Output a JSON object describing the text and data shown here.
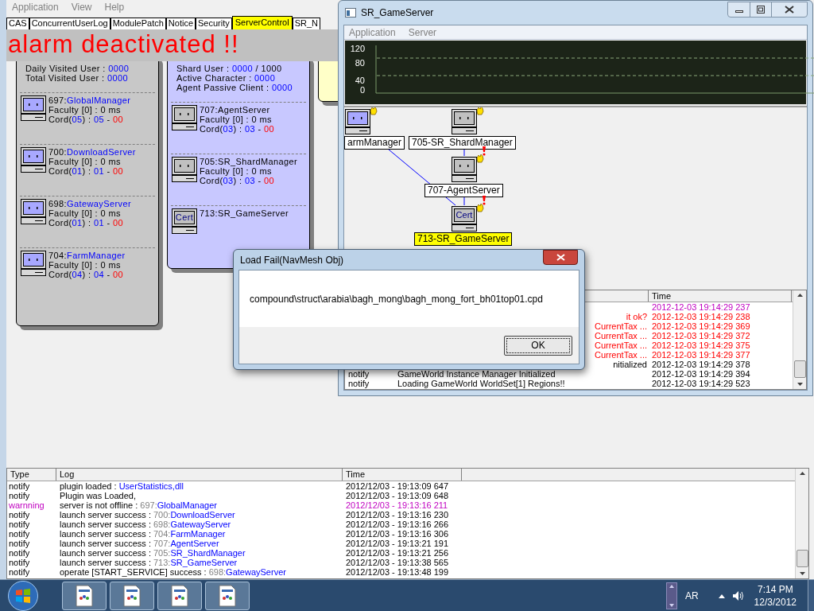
{
  "main_window": {
    "menu": [
      {
        "label": "Application"
      },
      {
        "label": "View"
      },
      {
        "label": "Help"
      }
    ],
    "tabs": [
      {
        "label": "CAS",
        "selected": false
      },
      {
        "label": "ConcurrentUserLog",
        "selected": false
      },
      {
        "label": "ModulePatch",
        "selected": false
      },
      {
        "label": "Notice",
        "selected": false
      },
      {
        "label": "Security",
        "selected": false
      },
      {
        "label": "ServerControl",
        "selected": true
      },
      {
        "label": "SR_N",
        "selected": false
      }
    ],
    "alarm": "alarm deactivated !!",
    "panels": [
      {
        "kind": "gray",
        "stats": [
          {
            "segments": [
              {
                "text": "Daily Visited User : ",
                "kind": "plain"
              },
              {
                "text": "0000",
                "kind": "link"
              }
            ]
          },
          {
            "segments": [
              {
                "text": "Total Visited User : ",
                "kind": "plain"
              },
              {
                "text": "0000",
                "kind": "link"
              }
            ]
          }
        ],
        "servers": [
          {
            "kind": "blue",
            "lines": [
              [
                {
                  "text": "697:",
                  "kind": "plain"
                },
                {
                  "text": "GlobalManager",
                  "kind": "link"
                }
              ],
              [
                {
                  "text": "Faculty [0] : 0 ms",
                  "kind": "plain"
                }
              ],
              [
                {
                  "text": "Cord(",
                  "kind": "plain"
                },
                {
                  "text": "05",
                  "kind": "link"
                },
                {
                  "text": ") : ",
                  "kind": "plain"
                },
                {
                  "text": "05",
                  "kind": "link"
                },
                {
                  "text": " - ",
                  "kind": "plain"
                },
                {
                  "text": "00",
                  "kind": "alert"
                }
              ]
            ]
          },
          {
            "kind": "blue",
            "lines": [
              [
                {
                  "text": "700:",
                  "kind": "plain"
                },
                {
                  "text": "DownloadServer",
                  "kind": "link"
                }
              ],
              [
                {
                  "text": "Faculty [0] : 0 ms",
                  "kind": "plain"
                }
              ],
              [
                {
                  "text": "Cord(",
                  "kind": "plain"
                },
                {
                  "text": "01",
                  "kind": "link"
                },
                {
                  "text": ") : ",
                  "kind": "plain"
                },
                {
                  "text": "01",
                  "kind": "link"
                },
                {
                  "text": " - ",
                  "kind": "plain"
                },
                {
                  "text": "00",
                  "kind": "alert"
                }
              ]
            ]
          },
          {
            "kind": "blue",
            "lines": [
              [
                {
                  "text": "698:",
                  "kind": "plain"
                },
                {
                  "text": "GatewayServer",
                  "kind": "link"
                }
              ],
              [
                {
                  "text": "Faculty [0] : 0 ms",
                  "kind": "plain"
                }
              ],
              [
                {
                  "text": "Cord(",
                  "kind": "plain"
                },
                {
                  "text": "01",
                  "kind": "link"
                },
                {
                  "text": ") : ",
                  "kind": "plain"
                },
                {
                  "text": "01",
                  "kind": "link"
                },
                {
                  "text": " - ",
                  "kind": "plain"
                },
                {
                  "text": "00",
                  "kind": "alert"
                }
              ]
            ]
          },
          {
            "kind": "blue",
            "lines": [
              [
                {
                  "text": "704:",
                  "kind": "plain"
                },
                {
                  "text": "FarmManager",
                  "kind": "link"
                }
              ],
              [
                {
                  "text": "Faculty [0] : 0 ms",
                  "kind": "plain"
                }
              ],
              [
                {
                  "text": "Cord(",
                  "kind": "plain"
                },
                {
                  "text": "04",
                  "kind": "link"
                },
                {
                  "text": ") : ",
                  "kind": "plain"
                },
                {
                  "text": "04",
                  "kind": "link"
                },
                {
                  "text": " - ",
                  "kind": "plain"
                },
                {
                  "text": "00",
                  "kind": "alert"
                }
              ]
            ]
          }
        ]
      },
      {
        "kind": "blue",
        "stats": [
          {
            "segments": [
              {
                "text": "Shard User : ",
                "kind": "plain"
              },
              {
                "text": "0000",
                "kind": "link"
              },
              {
                "text": " / 1000",
                "kind": "plain"
              }
            ]
          },
          {
            "segments": [
              {
                "text": "Active Character : ",
                "kind": "plain"
              },
              {
                "text": "0000",
                "kind": "link"
              }
            ]
          },
          {
            "segments": [
              {
                "text": "Agent Passive Client : ",
                "kind": "plain"
              },
              {
                "text": "0000",
                "kind": "link"
              }
            ]
          }
        ],
        "servers": [
          {
            "kind": "gray",
            "lines": [
              [
                {
                  "text": "707:AgentServer",
                  "kind": "plain"
                }
              ],
              [
                {
                  "text": "Faculty [0] : 0 ms",
                  "kind": "plain"
                }
              ],
              [
                {
                  "text": "Cord(",
                  "kind": "plain"
                },
                {
                  "text": "03",
                  "kind": "link"
                },
                {
                  "text": ") : ",
                  "kind": "plain"
                },
                {
                  "text": "03",
                  "kind": "link"
                },
                {
                  "text": " - ",
                  "kind": "plain"
                },
                {
                  "text": "00",
                  "kind": "alert"
                }
              ]
            ]
          },
          {
            "kind": "gray",
            "lines": [
              [
                {
                  "text": "705:SR_ShardManager",
                  "kind": "plain"
                }
              ],
              [
                {
                  "text": "Faculty [0] : 0 ms",
                  "kind": "plain"
                }
              ],
              [
                {
                  "text": "Cord(",
                  "kind": "plain"
                },
                {
                  "text": "03",
                  "kind": "link"
                },
                {
                  "text": ") : ",
                  "kind": "plain"
                },
                {
                  "text": "03",
                  "kind": "link"
                },
                {
                  "text": " - ",
                  "kind": "plain"
                },
                {
                  "text": "00",
                  "kind": "alert"
                }
              ]
            ]
          },
          {
            "kind": "cert",
            "icon_text": "Cert",
            "lines": [
              [
                {
                  "text": "713:SR_GameServer",
                  "kind": "plain"
                }
              ]
            ]
          }
        ]
      },
      {
        "kind": "yellow"
      }
    ],
    "log": {
      "columns": [
        "Type",
        "Log",
        "Time"
      ],
      "rows": [
        {
          "kind": "normal",
          "type": "notify",
          "segments": [
            {
              "text": "plugin loaded : ",
              "kind": "plain"
            },
            {
              "text": "UserStatistics,dll",
              "kind": "link"
            }
          ],
          "time": "2012/12/03 - 19:13:09 647"
        },
        {
          "kind": "normal",
          "type": "notify",
          "segments": [
            {
              "text": "Plugin was Loaded,",
              "kind": "plain"
            }
          ],
          "time": "2012/12/03 - 19:13:09 648"
        },
        {
          "kind": "warning",
          "type": "warnning",
          "segments": [
            {
              "text": "server is not offline : ",
              "kind": "plain"
            },
            {
              "text": "697:",
              "kind": "muted"
            },
            {
              "text": "GlobalManager",
              "kind": "link"
            }
          ],
          "time": "2012/12/03 - 19:13:16 211"
        },
        {
          "kind": "normal",
          "type": "notify",
          "segments": [
            {
              "text": "launch server success : ",
              "kind": "plain"
            },
            {
              "text": "700:",
              "kind": "muted"
            },
            {
              "text": "DownloadServer",
              "kind": "link"
            }
          ],
          "time": "2012/12/03 - 19:13:16 230"
        },
        {
          "kind": "normal",
          "type": "notify",
          "segments": [
            {
              "text": "launch server success : ",
              "kind": "plain"
            },
            {
              "text": "698:",
              "kind": "muted"
            },
            {
              "text": "GatewayServer",
              "kind": "link"
            }
          ],
          "time": "2012/12/03 - 19:13:16 266"
        },
        {
          "kind": "normal",
          "type": "notify",
          "segments": [
            {
              "text": "launch server success : ",
              "kind": "plain"
            },
            {
              "text": "704:",
              "kind": "muted"
            },
            {
              "text": "FarmManager",
              "kind": "link"
            }
          ],
          "time": "2012/12/03 - 19:13:16 306"
        },
        {
          "kind": "normal",
          "type": "notify",
          "segments": [
            {
              "text": "launch server success : ",
              "kind": "plain"
            },
            {
              "text": "707:",
              "kind": "muted"
            },
            {
              "text": "AgentServer",
              "kind": "link"
            }
          ],
          "time": "2012/12/03 - 19:13:21 191"
        },
        {
          "kind": "normal",
          "type": "notify",
          "segments": [
            {
              "text": "launch server success : ",
              "kind": "plain"
            },
            {
              "text": "705:",
              "kind": "muted"
            },
            {
              "text": "SR_ShardManager",
              "kind": "link"
            }
          ],
          "time": "2012/12/03 - 19:13:21 256"
        },
        {
          "kind": "normal",
          "type": "notify",
          "segments": [
            {
              "text": "launch server success : ",
              "kind": "plain"
            },
            {
              "text": "713:",
              "kind": "muted"
            },
            {
              "text": "SR_GameServer",
              "kind": "link"
            }
          ],
          "time": "2012/12/03 - 19:13:38 565"
        },
        {
          "kind": "normal",
          "type": "notify",
          "segments": [
            {
              "text": "operate [START_SERVICE] success : ",
              "kind": "plain"
            },
            {
              "text": "698:",
              "kind": "muted"
            },
            {
              "text": "GatewayServer",
              "kind": "link"
            }
          ],
          "time": "2012/12/03 - 19:13:48 199"
        }
      ]
    }
  },
  "server_window": {
    "title": "SR_GameServer",
    "menu": [
      {
        "label": "Application"
      },
      {
        "label": "Server"
      }
    ],
    "graph": {
      "tick_labels": [
        "120",
        "80",
        "40",
        "0"
      ]
    },
    "diagram": {
      "nodes": [
        {
          "label": "armManager",
          "kind": "blue",
          "alert": false,
          "selected": false
        },
        {
          "label": "705-SR_ShardManager",
          "kind": "gray",
          "alert": false,
          "selected": false
        },
        {
          "label": "707-AgentServer",
          "kind": "gray",
          "alert": true,
          "selected": false
        },
        {
          "label": "713-SR_GameServer",
          "kind": "cert",
          "icon_text": "Cert",
          "alert": true,
          "selected": true
        }
      ]
    },
    "log": {
      "time_column": "Time",
      "rows": [
        {
          "kind": "warning",
          "time": "2012-12-03 19:14:29 237"
        },
        {
          "kind": "error",
          "message": "it ok?",
          "time": "2012-12-03 19:14:29 238"
        },
        {
          "kind": "error",
          "message": "CurrentTax ...",
          "time": "2012-12-03 19:14:29 369"
        },
        {
          "kind": "error",
          "message": "CurrentTax ...",
          "time": "2012-12-03 19:14:29 372"
        },
        {
          "kind": "error",
          "message": "CurrentTax ...",
          "time": "2012-12-03 19:14:29 375"
        },
        {
          "kind": "error",
          "message": "CurrentTax ...",
          "time": "2012-12-03 19:14:29 377"
        },
        {
          "kind": "normal",
          "message": "nitialized",
          "time": "2012-12-03 19:14:29 378"
        },
        {
          "kind": "normal",
          "type": "notify",
          "message": "GameWorld Instance Manager Initialized",
          "time": "2012-12-03 19:14:29 394"
        },
        {
          "kind": "normal",
          "type": "notify",
          "message": "Loading GameWorld WorldSet[1] Regions!!",
          "time": "2012-12-03 19:14:29 523"
        }
      ]
    }
  },
  "dialog": {
    "title": "Load Fail(NavMesh Obj)",
    "message": "compound\\struct\\arabia\\bagh_mong\\bagh_mong_fort_bh01top01.cpd",
    "button": "OK"
  },
  "taskbar": {
    "tasks": [
      {
        "active": false
      },
      {
        "active": false
      },
      {
        "active": false
      },
      {
        "active": false
      }
    ],
    "language": "AR",
    "time": "7:14 PM",
    "date": "12/3/2012"
  }
}
